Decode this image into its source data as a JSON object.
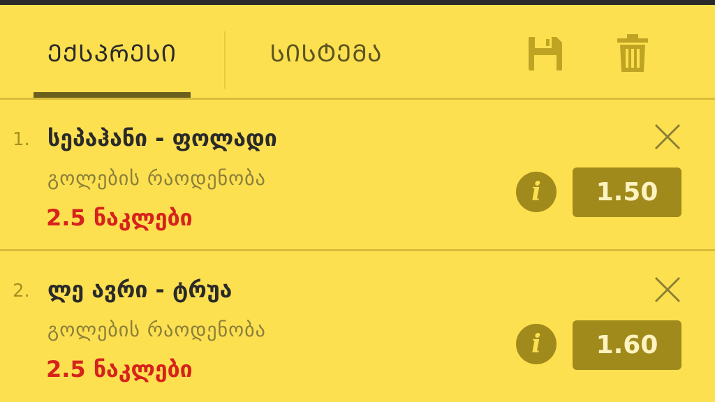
{
  "tabs": {
    "express_label": "ᲔᲥᲡᲞᲠᲔᲡᲘ",
    "system_label": "ᲡᲘᲡᲢᲔᲛᲐ"
  },
  "icons": {
    "save": "save-icon",
    "delete": "trash-icon",
    "close": "close-icon",
    "info": "info-icon"
  },
  "colors": {
    "background": "#fde050",
    "accent": "#a08a1c",
    "pick": "#d6221c",
    "title": "#2a2a2a"
  },
  "bets": [
    {
      "number": "1.",
      "match": "სეპაჰანი - ფოლადი",
      "market": "გოლების რაოდენობა",
      "pick": "2.5 ნაკლები",
      "odds": "1.50",
      "info_glyph": "i"
    },
    {
      "number": "2.",
      "match": "ლე ავრი - ტრუა",
      "market": "გოლების რაოდენობა",
      "pick": "2.5 ნაკლები",
      "odds": "1.60",
      "info_glyph": "i"
    }
  ]
}
